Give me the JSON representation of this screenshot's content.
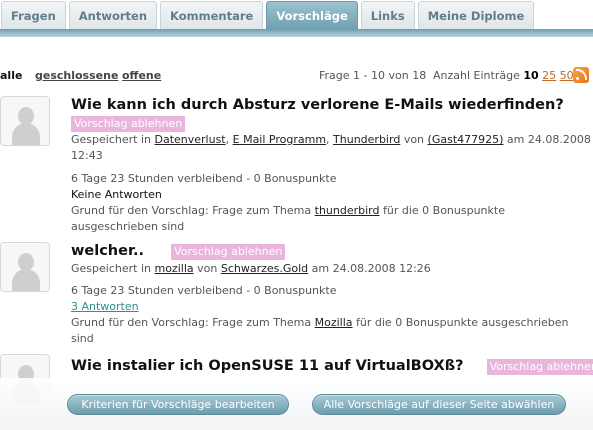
{
  "tabs": [
    "Fragen",
    "Antworten",
    "Kommentare",
    "Vorschläge",
    "Links",
    "Meine Diplome"
  ],
  "active_tab": "Vorschläge",
  "filters": {
    "all": "alle",
    "closed": "geschlossene",
    "open": "offene"
  },
  "pager": {
    "range": "Frage 1 - 10 von 18",
    "count_label": "Anzahl Einträge",
    "current": "10",
    "opt1": "25",
    "opt2": "50"
  },
  "reject_label": "Vorschlag ablehnen",
  "questions": [
    {
      "title": "Wie kann ich durch Absturz verlorene E-Mails wiederfinden?",
      "saved_in": "Gespeichert in",
      "categories": [
        "Datenverlust",
        "E Mail Programm",
        "Thunderbird"
      ],
      "by": "von",
      "author": "(Gast477925)",
      "date_prefix": "am 24.08.2008",
      "date_suffix": "12:43",
      "remaining": "6 Tage 23 Stunden verbleibend - 0 Bonuspunkte",
      "answers": "Keine Antworten",
      "reason_prefix": "Grund für den Vorschlag: Frage zum Thema",
      "reason_topic": "thunderbird",
      "reason_suffix": "für die 0 Bonuspunkte",
      "reason_end": "ausgeschrieben sind"
    },
    {
      "title": "welcher..",
      "saved_in": "Gespeichert in",
      "categories": [
        "mozilla"
      ],
      "by": "von",
      "author": "Schwarzes.Gold",
      "date": "am 24.08.2008 12:26",
      "remaining": "6 Tage 23 Stunden verbleibend - 0 Bonuspunkte",
      "answers": "3 Antworten",
      "reason_prefix": "Grund für den Vorschlag: Frage zum Thema",
      "reason_topic": "Mozilla",
      "reason_suffix": "für die 0 Bonuspunkte ausgeschrieben",
      "reason_end": "sind"
    },
    {
      "title": "Wie instalier ich OpenSUSE 11 auf VirtualBOXß?"
    }
  ],
  "buttons": {
    "edit_criteria": "Kriterien für Vorschläge bearbeiten",
    "deselect_all": "Alle Vorschläge auf dieser Seite abwählen"
  },
  "colors": {
    "accent": "#6e9fb0",
    "reject": "#e9b5dc",
    "answers_link": "#2d8f8f"
  }
}
